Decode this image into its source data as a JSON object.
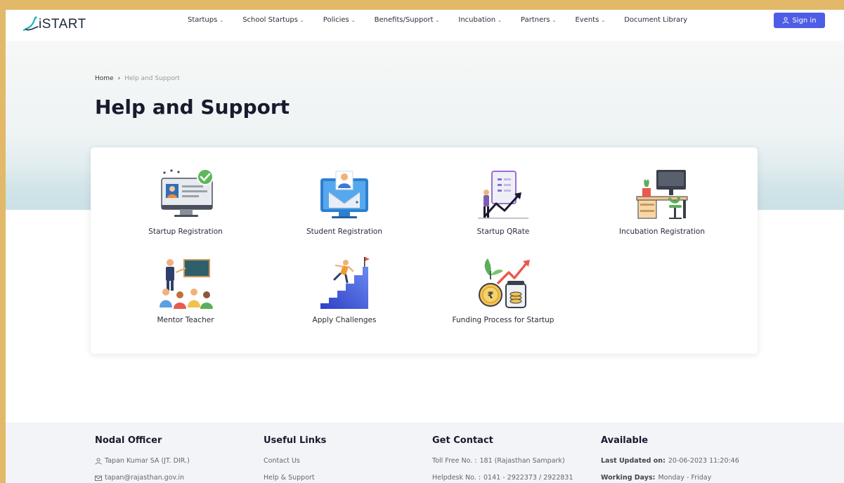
{
  "header": {
    "logo_text": "iSTART",
    "nav": [
      {
        "label": "Startups",
        "icon": "chevron-down-icon"
      },
      {
        "label": "School Startups",
        "icon": "chevron-down-icon"
      },
      {
        "label": "Policies",
        "icon": "chevron-down-icon"
      },
      {
        "label": "Benefits/Support",
        "icon": "chevron-down-icon"
      },
      {
        "label": "Incubation",
        "icon": "chevron-down-icon"
      },
      {
        "label": "Partners",
        "icon": "chevron-down-icon"
      },
      {
        "label": "Events",
        "icon": "chevron-down-icon"
      },
      {
        "label": "Document Library"
      }
    ],
    "signin_label": "Sign in",
    "signin_icon": "user-icon",
    "accent": "#4e5de6"
  },
  "breadcrumb": {
    "home": "Home",
    "separator": "›",
    "current": "Help and Support"
  },
  "page_title": "Help and Support",
  "tiles": [
    {
      "label": "Startup Registration",
      "icon": "monitor-profile-check-icon"
    },
    {
      "label": "Student Registration",
      "icon": "laptop-student-icon"
    },
    {
      "label": "Startup QRate",
      "icon": "growth-chart-person-icon"
    },
    {
      "label": "Incubation Registration",
      "icon": "desk-workspace-icon"
    },
    {
      "label": "Mentor Teacher",
      "icon": "classroom-teacher-icon"
    },
    {
      "label": "Apply Challenges",
      "icon": "stairs-climb-flag-icon"
    },
    {
      "label": "Funding Process for Startup",
      "icon": "rupee-coins-growth-icon"
    }
  ],
  "footer": {
    "nodal": {
      "heading": "Nodal Officer",
      "name": "Tapan Kumar SA (JT. DIR.)",
      "email": "tapan@rajasthan.gov.in"
    },
    "links": {
      "heading": "Useful Links",
      "items": [
        "Contact Us",
        "Help & Support"
      ]
    },
    "contact": {
      "heading": "Get Contact",
      "toll_label": "Toll Free No. :",
      "toll_value": "181 (Rajasthan Sampark)",
      "helpdesk_label": "Helpdesk No. :",
      "helpdesk_value": "0141 - 2922373 / 2922831"
    },
    "available": {
      "heading": "Available",
      "updated_label": "Last Updated on:",
      "updated_value": "20-06-2023 11:20:46",
      "days_label": "Working Days:",
      "days_value": "Monday - Friday"
    }
  }
}
